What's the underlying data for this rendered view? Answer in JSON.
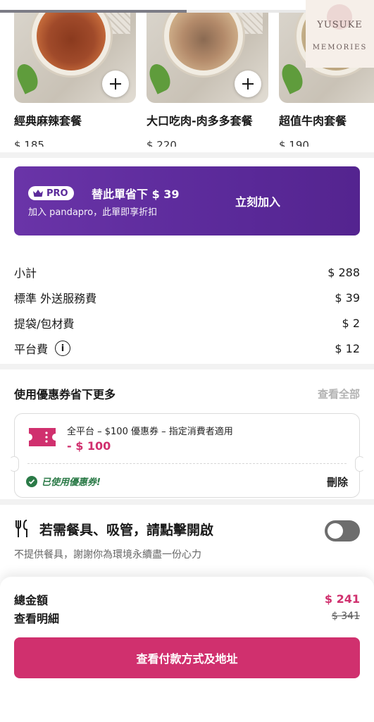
{
  "recommended": {
    "items": [
      {
        "name": "經典麻辣套餐",
        "price": "$ 185",
        "soup_color": "#a04a2a"
      },
      {
        "name": "大口吃肉-肉多多套餐",
        "price": "$ 220",
        "soup_color": "#c9a783"
      },
      {
        "name": "超值牛肉套餐",
        "price": "$ 190",
        "soup_color": "#b8a07a"
      }
    ],
    "add_icon": "plus-icon"
  },
  "watermark": {
    "line1": "YUSUKE",
    "line2": "MEMORIES"
  },
  "pro_banner": {
    "badge": "PRO",
    "title": "替此單省下 $ 39",
    "subtitle": "加入 pandapro，此單即享折扣",
    "cta": "立刻加入",
    "color": "#5b2a9a"
  },
  "fees": [
    {
      "label": "小計",
      "value": "$ 288",
      "info": false
    },
    {
      "label": "標準 外送服務費",
      "value": "$ 39",
      "info": false
    },
    {
      "label": "提袋/包材費",
      "value": "$ 2",
      "info": false
    },
    {
      "label": "平台費",
      "value": "$ 12",
      "info": true
    }
  ],
  "voucher": {
    "heading": "使用優惠券省下更多",
    "view_all": "查看全部",
    "title": "全平台 – $100 優惠券 – 指定消費者適用",
    "amount": "- $ 100",
    "used_label": "已使用優惠券!",
    "delete_label": "刪除",
    "accent": "#d0306e",
    "success": "#2b7a47"
  },
  "cutlery": {
    "title": "若需餐具、吸管，請點擊開啟",
    "subtitle": "不提供餐具，謝謝你為環境永續盡一份心力",
    "enabled": false
  },
  "summary": {
    "total_label": "總金額",
    "total_value": "$ 241",
    "detail_label": "查看明細",
    "original_value": "$ 341",
    "cta": "查看付款方式及地址",
    "accent": "#d0306e"
  }
}
